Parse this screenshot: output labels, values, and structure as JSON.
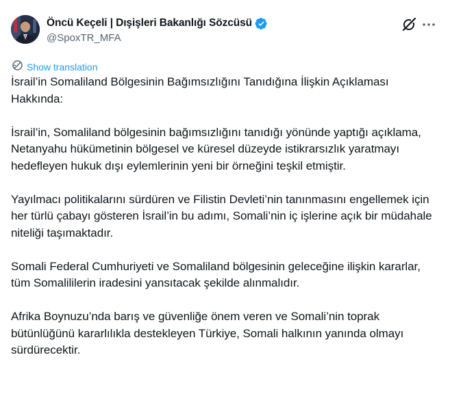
{
  "author": {
    "display_name": "Öncü Keçeli | Dışişleri Bakanlığı Sözcüsü",
    "handle": "@SpoxTR_MFA",
    "verified": true
  },
  "icons": {
    "avatar": "profile-photo",
    "verified": "verified-badge-icon",
    "grok": "grok-icon",
    "more": "more-dots-icon",
    "translate": "translate-globe-icon"
  },
  "colors": {
    "accent": "#1d9bf0",
    "text": "#0f1419",
    "secondary": "#536471"
  },
  "translation": {
    "label": "Show translation"
  },
  "post": {
    "paragraphs": [
      "İsrail’in Somaliland Bölgesinin Bağımsızlığını Tanıdığına İlişkin Açıklaması Hakkında:",
      "İsrail’in, Somaliland bölgesinin bağımsızlığını tanıdığı yönünde yaptığı açıklama, Netanyahu hükümetinin bölgesel ve küresel düzeyde istikrarsızlık yaratmayı hedefleyen hukuk dışı eylemlerinin yeni bir örneğini teşkil etmiştir.",
      "Yayılmacı politikalarını sürdüren ve Filistin Devleti’nin tanınmasını engellemek için her türlü çabayı gösteren İsrail’in bu adımı, Somali’nin iç işlerine açık bir müdahale niteliği taşımaktadır.",
      "Somali Federal Cumhuriyeti ve Somaliland bölgesinin geleceğine ilişkin kararlar, tüm Somalililerin iradesini yansıtacak şekilde alınmalıdır.",
      "Afrika Boynuzu’nda barış ve güvenliğe önem veren ve Somali’nin toprak bütünlüğünü kararlılıkla destekleyen Türkiye, Somali halkının yanında olmayı sürdürecektir."
    ]
  }
}
